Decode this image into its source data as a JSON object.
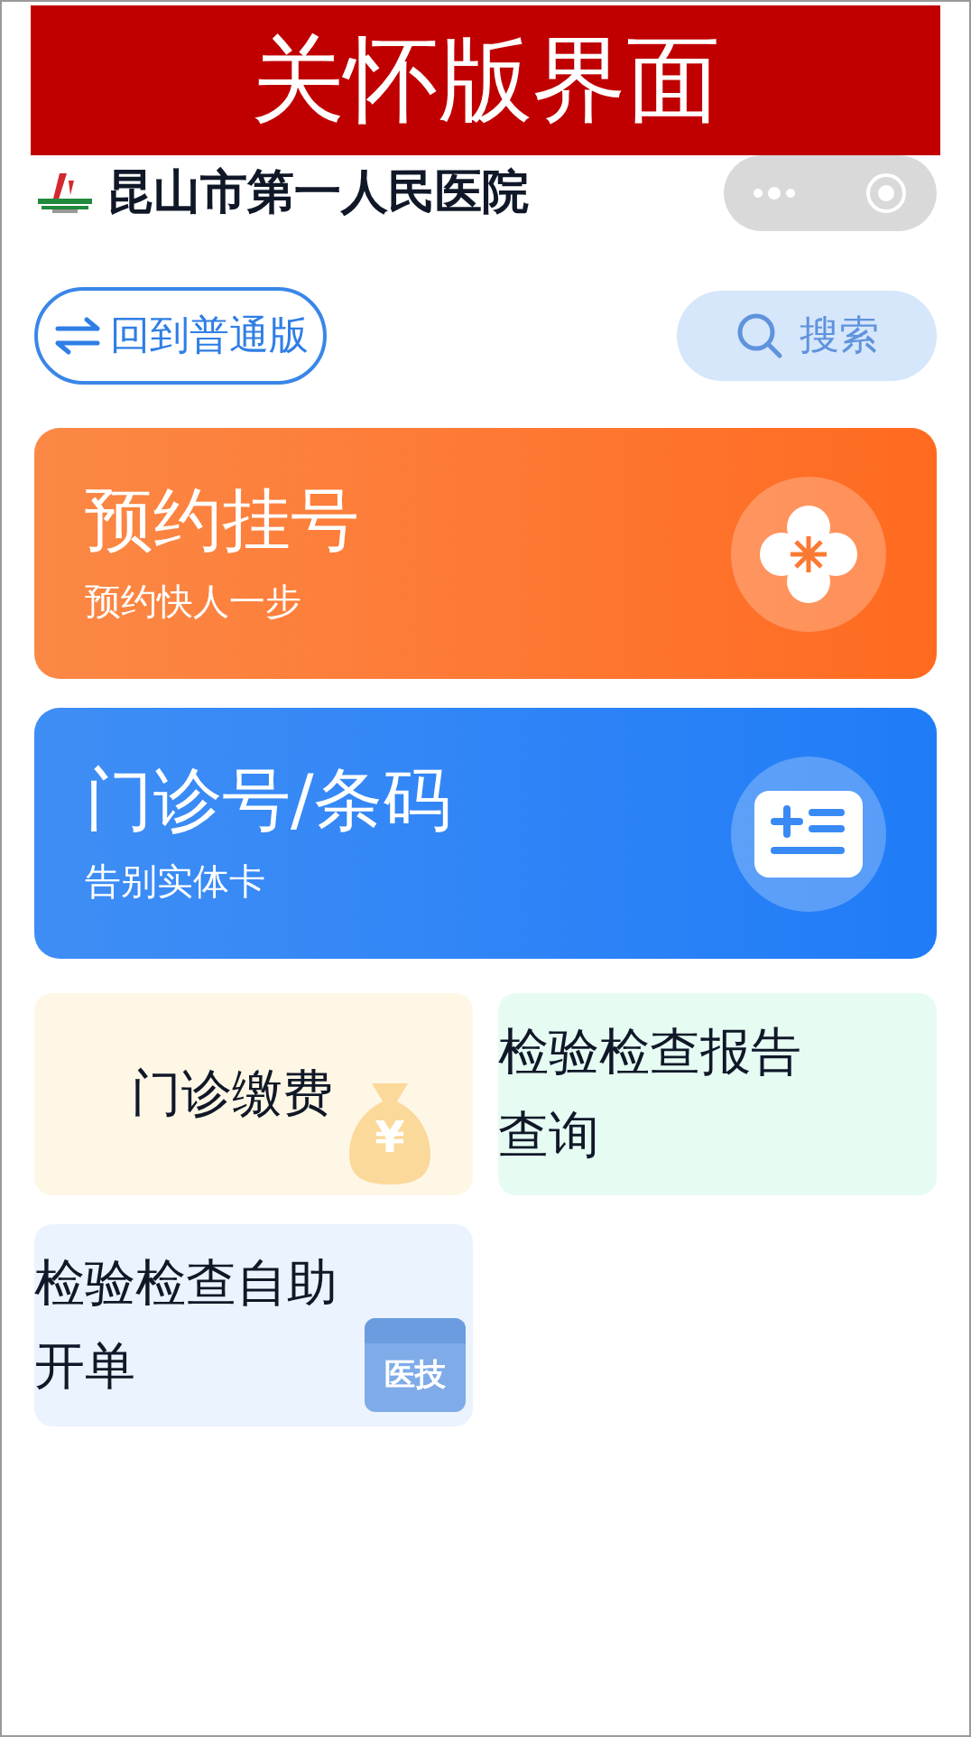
{
  "banner": {
    "title": "关怀版界面"
  },
  "header": {
    "hospital_name": "昆山市第一人民医院"
  },
  "toolbar": {
    "switch_label": "回到普通版",
    "search_label": "搜索"
  },
  "feature_cards": [
    {
      "kind": "appointment",
      "title": "预约挂号",
      "subtitle": "预约快人一步"
    },
    {
      "kind": "barcode",
      "title": "门诊号/条码",
      "subtitle": "告别实体卡"
    }
  ],
  "tiles": [
    {
      "kind": "payment",
      "title": "门诊缴费",
      "icon_text": "¥"
    },
    {
      "kind": "report",
      "title": "检验检查报告查询"
    },
    {
      "kind": "order",
      "title": "检验检查自助开单",
      "icon_text": "医技"
    }
  ]
}
